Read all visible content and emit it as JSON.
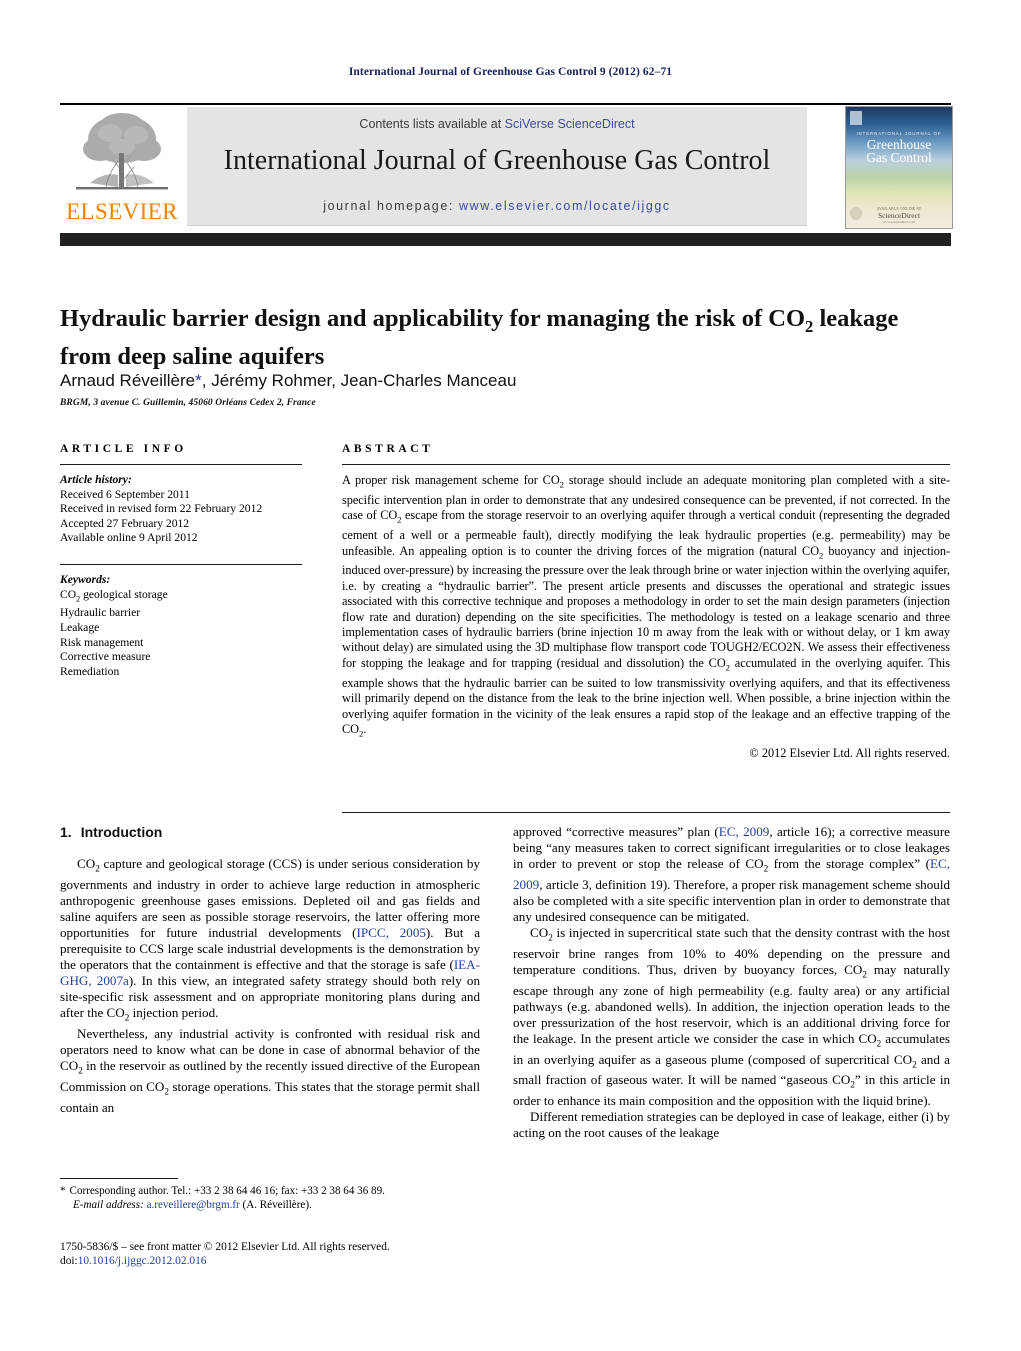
{
  "running_head": "International Journal of Greenhouse Gas Control 9 (2012) 62–71",
  "masthead": {
    "contents_prefix": "Contents lists available at ",
    "contents_link": "SciVerse ScienceDirect",
    "journal_title": "International Journal of Greenhouse Gas Control",
    "homepage_label": "journal homepage: ",
    "homepage_url": "www.elsevier.com/locate/ijggc",
    "publisher_wordmark": "ELSEVIER",
    "cover": {
      "smallcaps": "INTERNATIONAL JOURNAL OF",
      "line1": "Greenhouse",
      "line2": "Gas Control",
      "foot_small": "AVAILABLE ONLINE AT",
      "foot_brand": "ScienceDirect",
      "foot_sub": "www.sciencedirect.com"
    }
  },
  "article": {
    "title_line1": "Hydraulic barrier design and applicability for managing the risk of CO",
    "title_sub1": "2",
    "title_line1b": " leakage",
    "title_line2": "from deep saline aquifers",
    "authors": "Arnaud Réveillère",
    "authors_star": "*",
    "authors_rest": ", Jérémy Rohmer, Jean-Charles Manceau",
    "affiliation": "BRGM, 3 avenue C. Guillemin, 45060 Orléans Cedex 2, France"
  },
  "info": {
    "heading": "ARTICLE INFO",
    "history_label": "Article history:",
    "history": [
      "Received 6 September 2011",
      "Received in revised form 22 February 2012",
      "Accepted 27 February 2012",
      "Available online 9 April 2012"
    ],
    "keywords_label": "Keywords:",
    "keywords": [
      "CO2 geological storage",
      "Hydraulic barrier",
      "Leakage",
      "Risk management",
      "Corrective measure",
      "Remediation"
    ],
    "keyword_first_prefix": "CO",
    "keyword_first_sub": "2",
    "keyword_first_rest": " geological storage"
  },
  "abstract": {
    "heading": "ABSTRACT",
    "p1_a": "A proper risk management scheme for CO",
    "p1_b": " storage should include an adequate monitoring plan completed with a site-specific intervention plan in order to demonstrate that any undesired consequence can be prevented, if not corrected. In the case of CO",
    "p1_c": " escape from the storage reservoir to an overlying aquifer through a vertical conduit (representing the degraded cement of a well or a permeable fault), directly modifying the leak hydraulic properties (e.g. permeability) may be unfeasible. An appealing option is to counter the driving forces of the migration (natural CO",
    "p1_d": " buoyancy and injection-induced over-pressure) by increasing the pressure over the leak through brine or water injection within the overlying aquifer, i.e. by creating a “hydraulic barrier”. The present article presents and discusses the operational and strategic issues associated with this corrective technique and proposes a methodology in order to set the main design parameters (injection flow rate and duration) depending on the site specificities. The methodology is tested on a leakage scenario and three implementation cases of hydraulic barriers (brine injection 10 m away from the leak with or without delay, or 1 km away without delay) are simulated using the 3D multiphase flow transport code TOUGH2/ECO2N. We assess their effectiveness for stopping the leakage and for trapping (residual and dissolution) the CO",
    "p1_e": " accumulated in the overlying aquifer. This example shows that the hydraulic barrier can be suited to low transmissivity overlying aquifers, and that its effectiveness will primarily depend on the distance from the leak to the brine injection well. When possible, a brine injection within the overlying aquifer formation in the vicinity of the leak ensures a rapid stop of the leakage and an effective trapping of the CO",
    "p1_f": ".",
    "sub": "2",
    "copyright": "© 2012 Elsevier Ltd. All rights reserved."
  },
  "body": {
    "section1_num": "1.",
    "section1_title": "Introduction",
    "left_p1_a": "CO",
    "left_p1_b": " capture and geological storage (CCS) is under serious consideration by governments and industry in order to achieve large reduction in atmospheric anthropogenic greenhouse gases emissions. Depleted oil and gas fields and saline aquifers are seen as possible storage reservoirs, the latter offering more opportunities for future industrial developments (",
    "left_p1_cite1": "IPCC, 2005",
    "left_p1_c": "). But a prerequisite to CCS large scale industrial developments is the demonstration by the operators that the containment is effective and that the storage is safe (",
    "left_p1_cite2": "IEA-GHG, 2007a",
    "left_p1_d": "). In this view, an integrated safety strategy should both rely on site-specific risk assessment and on appropriate monitoring plans during and after the CO",
    "left_p1_e": " injection period.",
    "left_p2_a": "Nevertheless, any industrial activity is confronted with residual risk and operators need to know what can be done in case of abnormal behavior of the CO",
    "left_p2_b": " in the reservoir as outlined by the recently issued directive of the European Commission on CO",
    "left_p2_c": " storage operations. This states that the storage permit shall contain an",
    "right_p1_a": "approved “corrective measures” plan (",
    "right_p1_cite1": "EC, 2009",
    "right_p1_b": ", article 16); a corrective measure being “any measures taken to correct significant irregularities or to close leakages in order to prevent or stop the release of CO",
    "right_p1_c": " from the storage complex” (",
    "right_p1_cite2": "EC, 2009",
    "right_p1_d": ", article 3, definition 19). Therefore, a proper risk management scheme should also be completed with a site specific intervention plan in order to demonstrate that any undesired consequence can be mitigated.",
    "right_p2_a": "CO",
    "right_p2_b": " is injected in supercritical state such that the density contrast with the host reservoir brine ranges from 10% to 40% depending on the pressure and temperature conditions. Thus, driven by buoyancy forces, CO",
    "right_p2_c": " may naturally escape through any zone of high permeability (e.g. faulty area) or any artificial pathways (e.g. abandoned wells). In addition, the injection operation leads to the over pressurization of the host reservoir, which is an additional driving force for the leakage. In the present article we consider the case in which CO",
    "right_p2_d": " accumulates in an overlying aquifer as a gaseous plume (composed of supercritical CO",
    "right_p2_e": " and a small fraction of gaseous water. It will be named “gaseous CO",
    "right_p2_f": "” in this article in order to enhance its main composition and the opposition with the liquid brine).",
    "right_p3": "Different remediation strategies can be deployed in case of leakage, either (i) by acting on the root causes of the leakage",
    "sub": "2"
  },
  "footnote": {
    "star": "*",
    "corresponding": "Corresponding author. Tel.: +33 2 38 64 46 16; fax: +33 2 38 64 36 89.",
    "email_label": "E-mail address:",
    "email": "a.reveillere@brgm.fr",
    "email_owner": "(A. Réveillère).",
    "issn_line": "1750-5836/$ – see front matter © 2012 Elsevier Ltd. All rights reserved.",
    "doi_label": "doi:",
    "doi_value": "10.1016/j.ijggc.2012.02.016"
  },
  "colors": {
    "link": "#22409a",
    "running_head": "#16215b",
    "elsevier_orange": "#ef8200",
    "masthead_panel": "#e4e4e4",
    "rule_black": "#231f20"
  }
}
